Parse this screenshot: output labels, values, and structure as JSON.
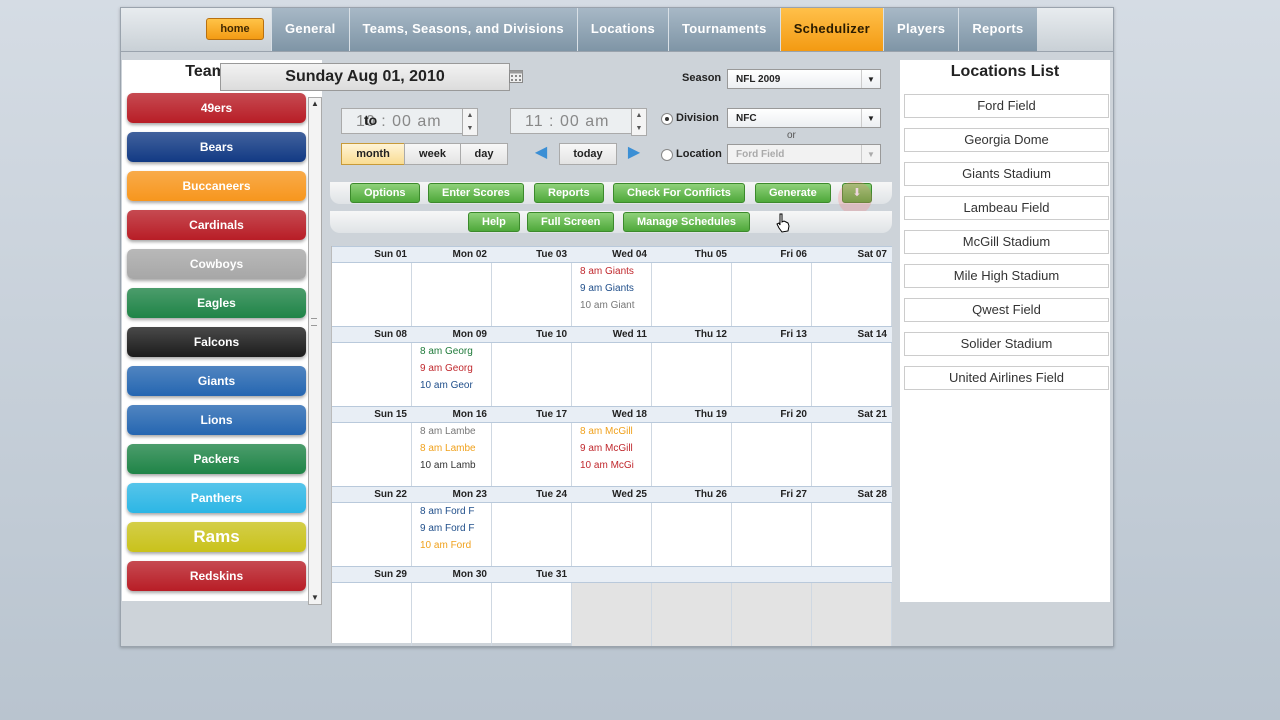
{
  "nav": {
    "home": "home",
    "tabs": [
      {
        "label": "General",
        "active": false
      },
      {
        "label": "Teams, Seasons, and Divisions",
        "active": false
      },
      {
        "label": "Locations",
        "active": false
      },
      {
        "label": "Tournaments",
        "active": false
      },
      {
        "label": "Schedulizer",
        "active": true
      },
      {
        "label": "Players",
        "active": false
      },
      {
        "label": "Reports",
        "active": false
      }
    ]
  },
  "team_list": {
    "title": "Team List",
    "teams": [
      {
        "name": "49ers",
        "color": "#b81d26"
      },
      {
        "name": "Bears",
        "color": "#123a84"
      },
      {
        "name": "Buccaneers",
        "color": "#f7961d"
      },
      {
        "name": "Cardinals",
        "color": "#b81d26"
      },
      {
        "name": "Cowboys",
        "color": "#a7a7a7"
      },
      {
        "name": "Eagles",
        "color": "#1f8447"
      },
      {
        "name": "Falcons",
        "color": "#1c1c1c"
      },
      {
        "name": "Giants",
        "color": "#2566b1"
      },
      {
        "name": "Lions",
        "color": "#2566b1"
      },
      {
        "name": "Packers",
        "color": "#1f8447"
      },
      {
        "name": "Panthers",
        "color": "#2cb6e5"
      },
      {
        "name": "Rams",
        "color": "#c9c21b"
      },
      {
        "name": "Redskins",
        "color": "#b81d26"
      }
    ]
  },
  "date_header": "Sunday Aug 01, 2010",
  "time": {
    "start": "10 :  00  am",
    "to": "to",
    "end": "11 :  00  am"
  },
  "views": {
    "month": "month",
    "week": "week",
    "day": "day",
    "today": "today"
  },
  "filters": {
    "season_label": "Season",
    "season_value": "NFL 2009",
    "division_label": "Division",
    "division_value": "NFC",
    "or": "or",
    "location_label": "Location",
    "location_value": "Ford Field"
  },
  "toolbar1": [
    "Options",
    "Enter Scores",
    "Reports",
    "Check For Conflicts",
    "Generate"
  ],
  "toolbar2": [
    "Help",
    "Full Screen",
    "Manage Schedules"
  ],
  "calendar": {
    "weeks": [
      {
        "days": [
          "Sun 01",
          "Mon 02",
          "Tue 03",
          "Wed 04",
          "Thu 05",
          "Fri 06",
          "Sat 07"
        ],
        "events": [
          [],
          [],
          [],
          [
            {
              "t": "8 am Giants",
              "c": "#c0282d"
            },
            {
              "t": "9 am Giants",
              "c": "#1f4e8a"
            },
            {
              "t": "10 am Giant",
              "c": "#777777"
            }
          ],
          [],
          [],
          []
        ]
      },
      {
        "days": [
          "Sun 08",
          "Mon 09",
          "Tue 10",
          "Wed 11",
          "Thu 12",
          "Fri 13",
          "Sat 14"
        ],
        "events": [
          [],
          [
            {
              "t": "8 am Georg",
              "c": "#1f7a3a"
            },
            {
              "t": "9 am Georg",
              "c": "#c0282d"
            },
            {
              "t": "10 am Geor",
              "c": "#1f4e8a"
            }
          ],
          [],
          [],
          [],
          [],
          []
        ]
      },
      {
        "days": [
          "Sun 15",
          "Mon 16",
          "Tue 17",
          "Wed 18",
          "Thu 19",
          "Fri 20",
          "Sat 21"
        ],
        "events": [
          [],
          [
            {
              "t": "8 am Lambe",
              "c": "#777777"
            },
            {
              "t": "8 am Lambe",
              "c": "#f0a11c"
            },
            {
              "t": "10 am Lamb",
              "c": "#333333"
            }
          ],
          [],
          [
            {
              "t": "8 am McGill",
              "c": "#f0a11c"
            },
            {
              "t": "9 am McGill",
              "c": "#c0282d"
            },
            {
              "t": "10 am McGi",
              "c": "#c0282d"
            }
          ],
          [],
          [],
          []
        ]
      },
      {
        "days": [
          "Sun 22",
          "Mon 23",
          "Tue 24",
          "Wed 25",
          "Thu 26",
          "Fri 27",
          "Sat 28"
        ],
        "events": [
          [],
          [
            {
              "t": "8 am Ford F",
              "c": "#1f4e8a"
            },
            {
              "t": "9 am Ford F",
              "c": "#1f4e8a"
            },
            {
              "t": "10 am Ford",
              "c": "#f0a11c"
            }
          ],
          [],
          [],
          [],
          [],
          []
        ]
      },
      {
        "days": [
          "Sun 29",
          "Mon 30",
          "Tue 31",
          "",
          "",
          "",
          ""
        ],
        "events": [
          [],
          [],
          [],
          [],
          [],
          [],
          []
        ]
      }
    ]
  },
  "locations": {
    "title": "Locations List",
    "items": [
      "Ford Field",
      "Georgia Dome",
      "Giants Stadium",
      "Lambeau Field",
      "McGill Stadium",
      "Mile High Stadium",
      "Qwest Field",
      "Solider Stadium",
      "United Airlines Field"
    ]
  }
}
